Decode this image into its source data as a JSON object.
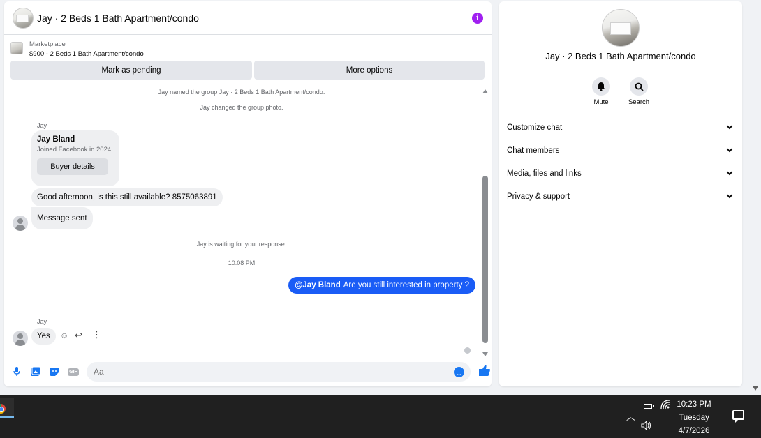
{
  "chat": {
    "title": "Jay · 2 Beds 1 Bath Apartment/condo",
    "marketplace_label": "Marketplace",
    "listing": "$900 - 2 Beds 1 Bath Apartment/condo",
    "mark_pending": "Mark as pending",
    "more_options": "More options",
    "sys_named": "Jay named the group Jay · 2 Beds 1 Bath Apartment/condo.",
    "sys_photo": "Jay changed the group photo.",
    "sender1": "Jay",
    "card_name": "Jay Bland",
    "card_joined": "Joined Facebook in 2024",
    "buyer_details": "Buyer details",
    "msg_available": "Good afternoon, is this still available? 8575063891",
    "msg_sent": "Message sent",
    "sys_waiting": "Jay is waiting for your response.",
    "time": "10:08 PM",
    "out_mention": "@Jay Bland",
    "out_text": "Are you still interested in property ?",
    "sender2": "Jay",
    "msg_yes": "Yes",
    "input_placeholder": "Aa"
  },
  "info": {
    "title": "Jay · 2 Beds 1 Bath Apartment/condo",
    "mute": "Mute",
    "search": "Search",
    "sections": [
      "Customize chat",
      "Chat members",
      "Media, files and links",
      "Privacy & support"
    ]
  },
  "taskbar": {
    "time": "10:23 PM",
    "day": "Tuesday",
    "date": "4/7/2026"
  },
  "colors": {
    "accent": "#1877f2",
    "outgoing_bubble": "#1a5cf6",
    "info_icon": "#a020f0"
  }
}
